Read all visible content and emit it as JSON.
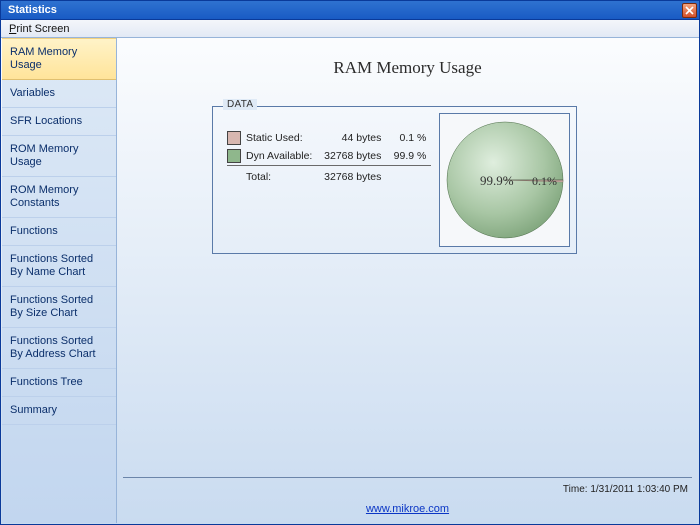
{
  "window": {
    "title": "Statistics"
  },
  "menu": {
    "print_screen": "Print Screen"
  },
  "sidebar": {
    "items": [
      {
        "label": "RAM Memory Usage",
        "selected": true
      },
      {
        "label": "Variables"
      },
      {
        "label": "SFR Locations"
      },
      {
        "label": "ROM Memory Usage"
      },
      {
        "label": "ROM Memory Constants"
      },
      {
        "label": "Functions"
      },
      {
        "label": "Functions Sorted By Name Chart"
      },
      {
        "label": "Functions Sorted By Size Chart"
      },
      {
        "label": "Functions Sorted By Address Chart"
      },
      {
        "label": "Functions Tree"
      },
      {
        "label": "Summary"
      }
    ]
  },
  "page": {
    "title": "RAM Memory Usage"
  },
  "group": {
    "label": "DATA"
  },
  "legend": {
    "static_used": {
      "label": "Static Used:",
      "value": "44 bytes",
      "pct": "0.1 %",
      "color": "#d7b7b0"
    },
    "dyn_available": {
      "label": "Dyn Available:",
      "value": "32768 bytes",
      "pct": "99.9 %",
      "color": "#8fb78c"
    },
    "total": {
      "label": "Total:",
      "value": "32768 bytes"
    }
  },
  "footer": {
    "time_label": "Time: 1/31/2011 1:03:40 PM",
    "link_text": "www.mikroe.com"
  },
  "chart_data": {
    "type": "pie",
    "title": "RAM Memory Usage",
    "series": [
      {
        "name": "Dyn Available",
        "value": 32724,
        "pct": 99.9,
        "color": "#8fb78c",
        "label": "99.9%"
      },
      {
        "name": "Static Used",
        "value": 44,
        "pct": 0.1,
        "color": "#d7b7b0",
        "label": "0.1%"
      }
    ],
    "total": 32768
  }
}
